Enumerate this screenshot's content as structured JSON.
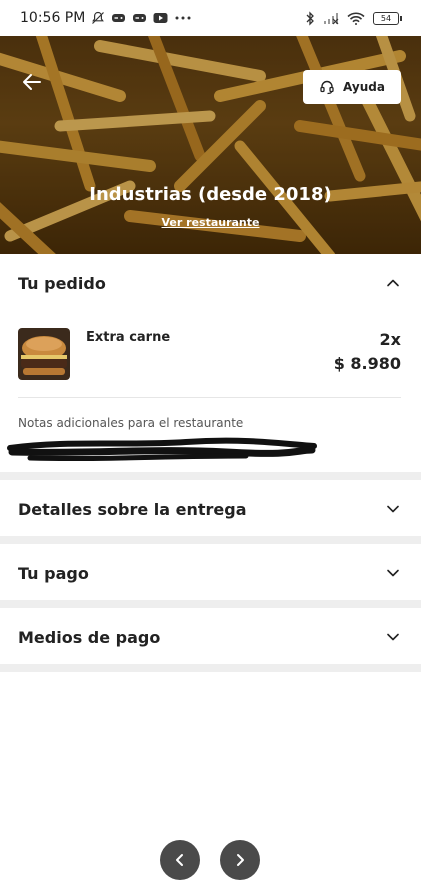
{
  "status_bar": {
    "time": "10:56 PM",
    "battery": "54",
    "icons": [
      "bell-off-icon",
      "game-controller-icon",
      "game-controller-icon",
      "youtube-icon",
      "more-dots-icon",
      "bluetooth-icon",
      "signal-off-icon",
      "wifi-icon"
    ]
  },
  "hero": {
    "restaurant_name": "Industrias (desde 2018)",
    "view_restaurant_link": "Ver restaurante",
    "help_button_label": "Ayuda",
    "back_icon": "arrow-left-icon",
    "help_icon": "headset-icon"
  },
  "order": {
    "section_title": "Tu pedido",
    "expanded": true,
    "item": {
      "name": "Extra carne",
      "quantity": "2x",
      "price": "$ 8.980",
      "thumb_icon": "burger-image"
    },
    "notes_label": "Notas adicionales para el restaurante"
  },
  "sections": [
    {
      "title": "Detalles sobre la entrega",
      "expanded": false
    },
    {
      "title": "Tu pago",
      "expanded": false
    },
    {
      "title": "Medios de pago",
      "expanded": false
    }
  ],
  "colors": {
    "text_primary": "#222222",
    "section_gap": "#eeeeee",
    "nav_arrow_bg": "#4a4a4a"
  }
}
